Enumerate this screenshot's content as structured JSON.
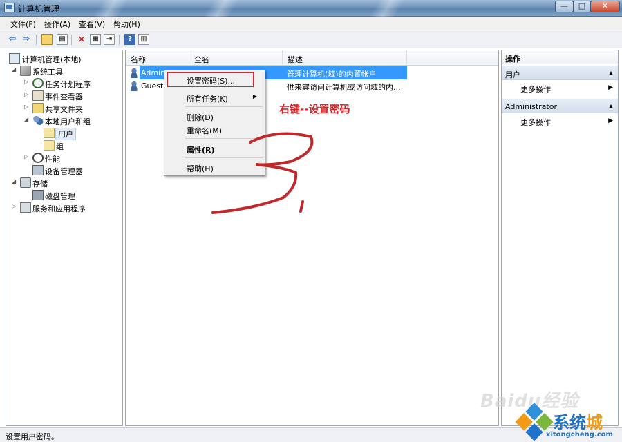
{
  "window": {
    "title": "计算机管理",
    "controls": {
      "minimize": "—",
      "maximize": "□",
      "close": "✕"
    }
  },
  "menu": [
    "文件(F)",
    "操作(A)",
    "查看(V)",
    "帮助(H)"
  ],
  "toolbar": {
    "back": "⇦",
    "forward": "⇨",
    "icons": [
      "back-icon",
      "forward-icon",
      "up-icon",
      "show-hide-tree-icon",
      "delete-icon",
      "properties-icon",
      "export-icon",
      "help-icon",
      "show-hide-action-pane-icon"
    ]
  },
  "tree": [
    {
      "label": "计算机管理(本地)",
      "toggle": "",
      "icon": "computer-icon",
      "level": 0
    },
    {
      "label": "系统工具",
      "toggle": "◢",
      "icon": "tools-icon",
      "level": 1
    },
    {
      "label": "任务计划程序",
      "toggle": "▷",
      "icon": "clock-icon",
      "level": 2
    },
    {
      "label": "事件查看器",
      "toggle": "▷",
      "icon": "event-viewer-icon",
      "level": 2
    },
    {
      "label": "共享文件夹",
      "toggle": "▷",
      "icon": "shared-folder-icon",
      "level": 2
    },
    {
      "label": "本地用户和组",
      "toggle": "◢",
      "icon": "users-groups-icon",
      "level": 2
    },
    {
      "label": "用户",
      "toggle": "",
      "icon": "folder-icon",
      "level": 3,
      "selected": true
    },
    {
      "label": "组",
      "toggle": "",
      "icon": "folder-icon",
      "level": 3
    },
    {
      "label": "性能",
      "toggle": "▷",
      "icon": "performance-icon",
      "level": 2
    },
    {
      "label": "设备管理器",
      "toggle": "",
      "icon": "device-manager-icon",
      "level": 2
    },
    {
      "label": "存储",
      "toggle": "◢",
      "icon": "storage-icon",
      "level": 1
    },
    {
      "label": "磁盘管理",
      "toggle": "",
      "icon": "disk-icon",
      "level": 2
    },
    {
      "label": "服务和应用程序",
      "toggle": "▷",
      "icon": "services-icon",
      "level": 1
    }
  ],
  "list": {
    "columns": [
      "名称",
      "全名",
      "描述"
    ],
    "rows": [
      {
        "name": "Admin",
        "full_name": "",
        "description": "管理计算机(域)的内置帐户",
        "selected": true
      },
      {
        "name": "Guest",
        "full_name": "",
        "description": "供来宾访问计算机或访问域的内...",
        "selected": false
      }
    ]
  },
  "context_menu": {
    "items": [
      {
        "label": "设置密码(S)...",
        "bold": false,
        "submenu": false
      },
      {
        "label": "所有任务(K)",
        "bold": false,
        "submenu": true
      },
      {
        "label": "删除(D)",
        "bold": false,
        "submenu": false
      },
      {
        "label": "重命名(M)",
        "bold": false,
        "submenu": false
      },
      {
        "label": "属性(R)",
        "bold": true,
        "submenu": false
      },
      {
        "label": "帮助(H)",
        "bold": false,
        "submenu": false
      }
    ],
    "submenu_arrow": "▶"
  },
  "annotation": {
    "text": "右键--设置密码",
    "color": "#d3262a"
  },
  "actions": {
    "title": "操作",
    "sections": [
      {
        "label": "用户",
        "item": "更多操作"
      },
      {
        "label": "Administrator",
        "item": "更多操作"
      }
    ],
    "collapse_caret": "▲",
    "item_caret": "▶"
  },
  "status": {
    "text": "设置用户密码。"
  },
  "watermarks": {
    "baidu": "Baidu经验",
    "site_cn": "系统城",
    "site_accent": "城",
    "site_main": "系统",
    "url": "xitongcheng.com"
  },
  "colors": {
    "selection": "#3399ff",
    "annotation": "#d3262a",
    "watermark_blue": "#1f73c9",
    "watermark_orange": "#f09a16"
  }
}
